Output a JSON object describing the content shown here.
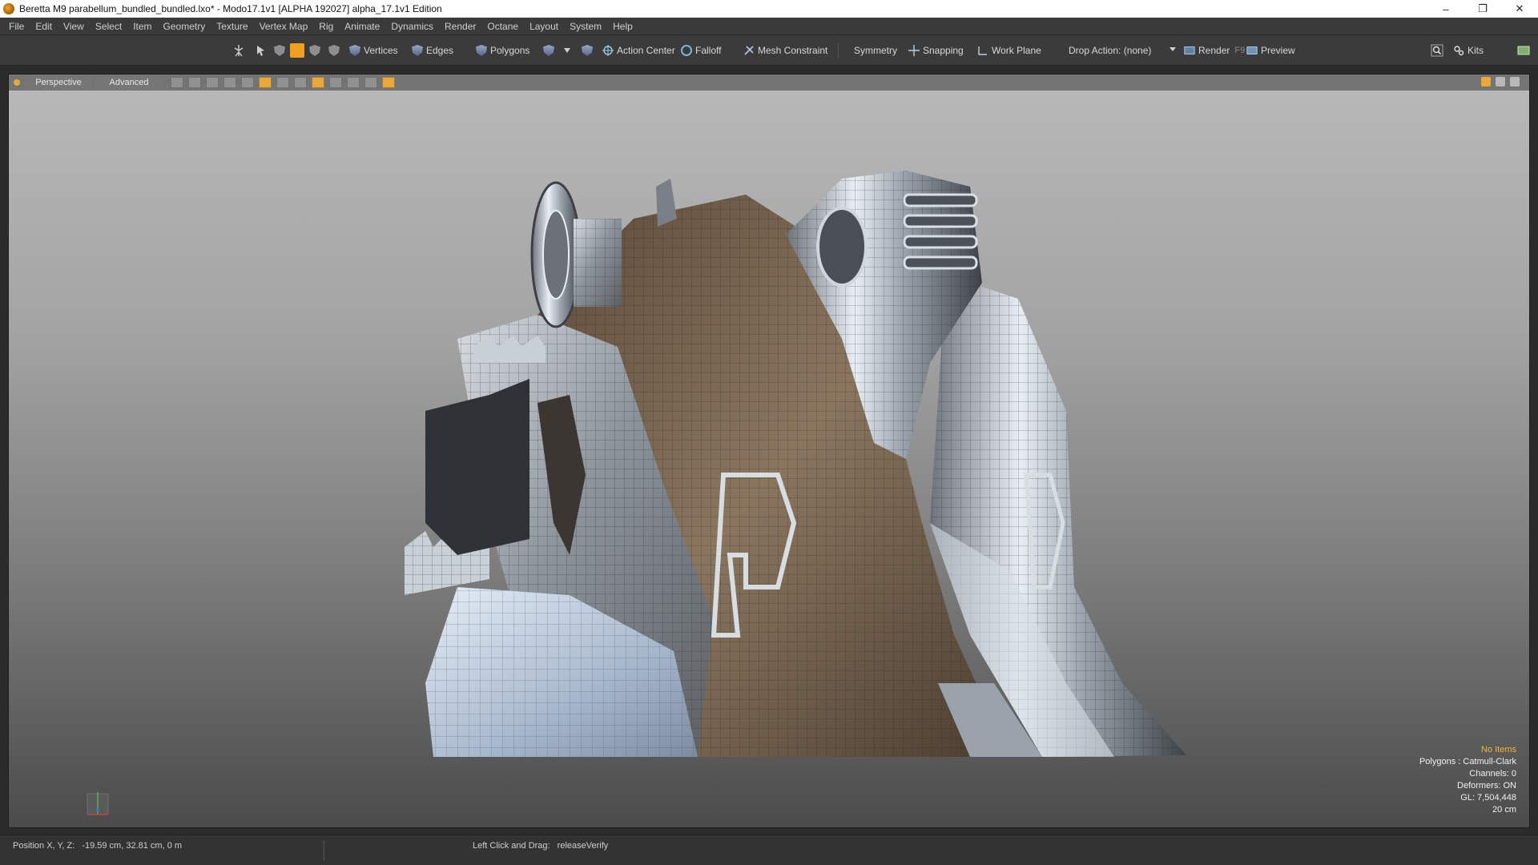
{
  "window": {
    "title": "Beretta M9 parabellum_bundled_bundled.lxo* - Modo17.1v1 [ALPHA 192027]   alpha_17.1v1 Edition",
    "minimize": "–",
    "maximize": "❐",
    "close": "✕"
  },
  "menu": [
    "File",
    "Edit",
    "View",
    "Select",
    "Item",
    "Geometry",
    "Texture",
    "Vertex Map",
    "Rig",
    "Animate",
    "Dynamics",
    "Render",
    "Octane",
    "Layout",
    "System",
    "Help"
  ],
  "toolbar": {
    "vertices": "Vertices",
    "edges": "Edges",
    "polygons": "Polygons",
    "action_center": "Action Center",
    "falloff": "Falloff",
    "mesh_constraint": "Mesh Constraint",
    "symmetry": "Symmetry",
    "snapping": "Snapping",
    "work_plane": "Work Plane",
    "drop_action": "Drop Action: (none)",
    "render": "Render",
    "render_key": "F9",
    "preview": "Preview",
    "kits": "Kits"
  },
  "viewport": {
    "tab_perspective": "Perspective",
    "tab_advanced": "Advanced",
    "info": {
      "items": "No Items",
      "polygons": "Polygons : Catmull-Clark",
      "channels": "Channels: 0",
      "deformers": "Deformers: ON",
      "gl": "GL: 7,504,448",
      "scale": "20 cm"
    }
  },
  "status": {
    "position_label": "Position X, Y, Z:",
    "position_value": "-19.59 cm, 32.81 cm, 0 m",
    "hint_label": "Left Click and Drag:",
    "hint_value": "releaseVerify"
  },
  "colors": {
    "accent": "#f0a020",
    "info_warn": "#f2b43c"
  }
}
